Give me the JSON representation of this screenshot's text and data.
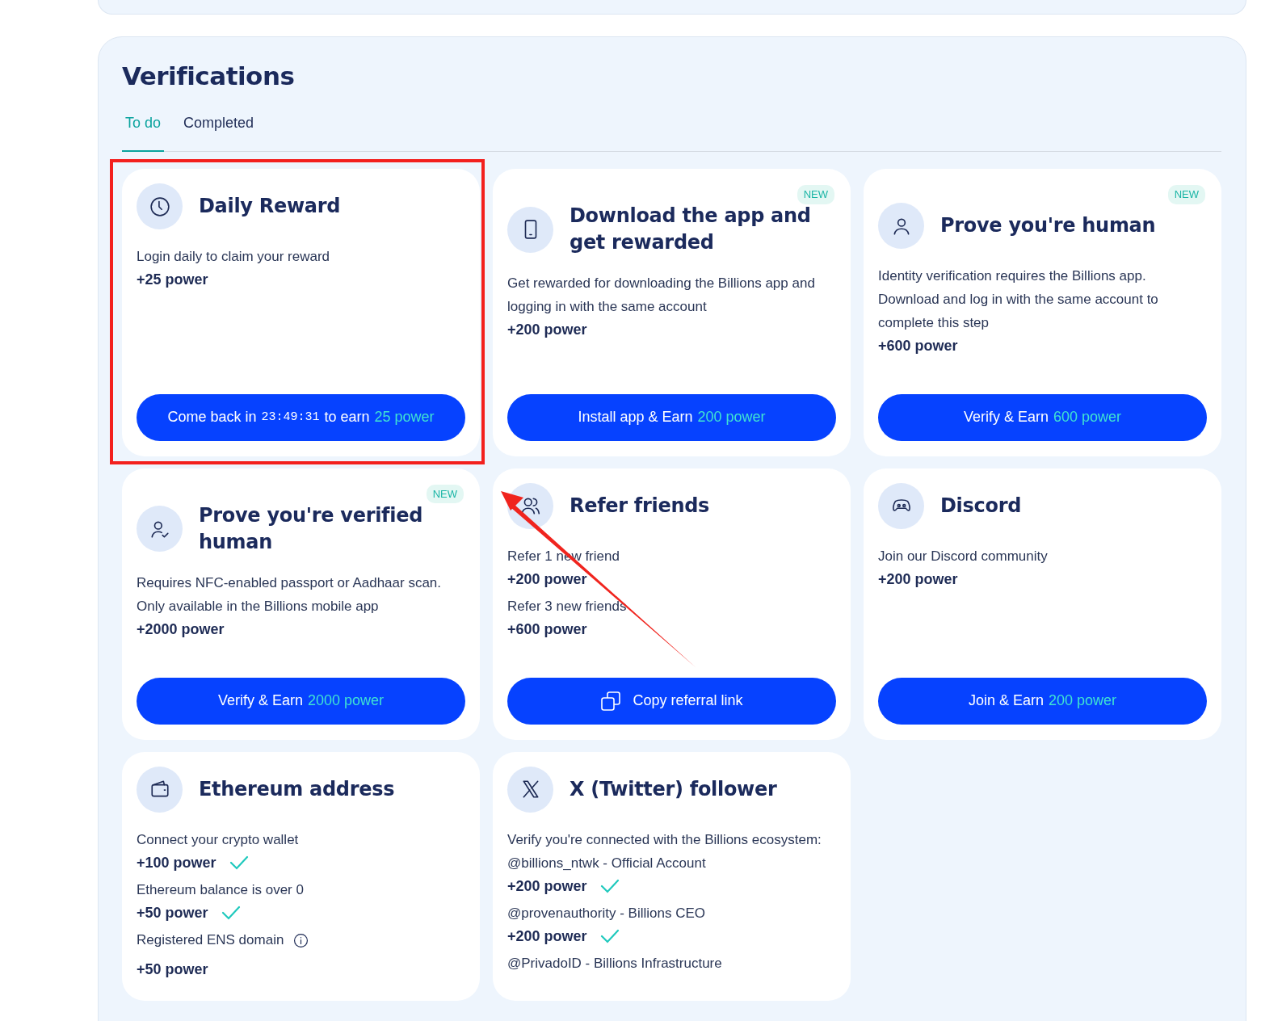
{
  "title": "Verifications",
  "tabs": [
    {
      "label": "To do",
      "selected": true
    },
    {
      "label": "Completed",
      "selected": false
    }
  ],
  "cards": [
    {
      "title": "Daily Reward",
      "new": false,
      "lines": [
        {
          "kind": "text",
          "text": "Login daily to claim your reward"
        },
        {
          "kind": "power",
          "text": "+25 power"
        }
      ],
      "button": {
        "kind": "earn",
        "parts": [
          {
            "kind": "text",
            "text": "Come back in"
          },
          {
            "kind": "mono",
            "text": "23:49:31"
          },
          {
            "kind": "text",
            "text": "to earn"
          },
          {
            "kind": "accent",
            "text": "25 power"
          }
        ]
      }
    },
    {
      "title": "Download the app and get rewarded",
      "new": true,
      "badge": "NEW",
      "lines": [
        {
          "kind": "text",
          "text": "Get rewarded for downloading the Billions app and logging in with the same account"
        },
        {
          "kind": "power",
          "text": "+200 power"
        }
      ],
      "button": {
        "kind": "earn",
        "parts": [
          {
            "kind": "text",
            "text": "Install app & Earn"
          },
          {
            "kind": "accent",
            "text": "200 power"
          }
        ]
      }
    },
    {
      "title": "Prove you're human",
      "new": true,
      "badge": "NEW",
      "lines": [
        {
          "kind": "text",
          "text": "Identity verification requires the Billions app. Download and log in with the same account to complete this step"
        },
        {
          "kind": "power",
          "text": "+600 power"
        }
      ],
      "button": {
        "kind": "earn",
        "parts": [
          {
            "kind": "text",
            "text": "Verify & Earn"
          },
          {
            "kind": "accent",
            "text": "600 power"
          }
        ]
      }
    },
    {
      "title": "Prove you're verified human",
      "new": true,
      "badge": "NEW",
      "lines": [
        {
          "kind": "text",
          "text": "Requires NFC-enabled passport or Aadhaar scan. Only available in the Billions mobile app"
        },
        {
          "kind": "power",
          "text": "+2000 power"
        }
      ],
      "button": {
        "kind": "earn",
        "parts": [
          {
            "kind": "text",
            "text": "Verify & Earn"
          },
          {
            "kind": "accent",
            "text": "2000 power"
          }
        ]
      }
    },
    {
      "title": "Refer friends",
      "new": false,
      "lines": [
        {
          "kind": "text",
          "text": "Refer 1 new friend"
        },
        {
          "kind": "power",
          "text": "+200 power"
        },
        {
          "kind": "text",
          "text": "Refer 3 new friends"
        },
        {
          "kind": "power",
          "text": "+600 power"
        }
      ],
      "button": {
        "kind": "copy",
        "parts": [
          {
            "kind": "text",
            "text": "Copy referral link"
          }
        ]
      }
    },
    {
      "title": "Discord",
      "new": false,
      "lines": [
        {
          "kind": "text",
          "text": "Join our Discord community"
        },
        {
          "kind": "power",
          "text": "+200 power"
        }
      ],
      "button": {
        "kind": "earn",
        "parts": [
          {
            "kind": "text",
            "text": "Join & Earn"
          },
          {
            "kind": "accent",
            "text": "200 power"
          }
        ]
      }
    },
    {
      "title": "Ethereum address",
      "new": false,
      "lines": [
        {
          "kind": "text",
          "text": "Connect your crypto wallet"
        },
        {
          "kind": "power",
          "text": "+100 power",
          "checked": true
        },
        {
          "kind": "text",
          "text": "Ethereum balance is over 0"
        },
        {
          "kind": "power",
          "text": "+50 power",
          "checked": true
        },
        {
          "kind": "info",
          "text": "Registered ENS domain"
        },
        {
          "kind": "power",
          "text": "+50 power",
          "checked": false
        }
      ]
    },
    {
      "title": "X (Twitter) follower",
      "new": false,
      "lines": [
        {
          "kind": "text",
          "text": "Verify you're connected with the Billions ecosystem:"
        },
        {
          "kind": "text",
          "text": "@billions_ntwk - Official Account"
        },
        {
          "kind": "power",
          "text": "+200 power",
          "checked": true
        },
        {
          "kind": "text",
          "text": "@provenauthority - Billions CEO"
        },
        {
          "kind": "power",
          "text": "+200 power",
          "checked": true
        },
        {
          "kind": "text",
          "text": "@PrivadoID - Billions Infrastructure"
        }
      ]
    }
  ]
}
